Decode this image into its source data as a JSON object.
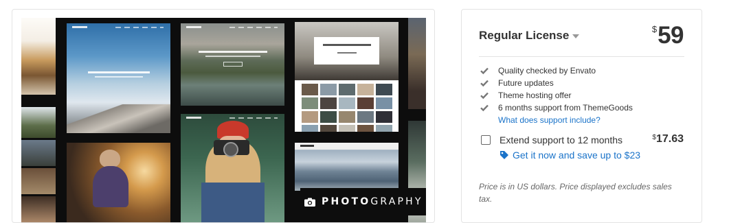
{
  "preview": {
    "logo_text_bold": "PHOTO",
    "logo_text_thin": "GRAPHY"
  },
  "purchase": {
    "license_title": "Regular License",
    "currency_symbol": "$",
    "price": "59",
    "features": [
      "Quality checked by Envato",
      "Future updates",
      "Theme hosting offer",
      "6 months support from ThemeGoods"
    ],
    "support_link": "What does support include?",
    "extend_label": "Extend support to 12 months",
    "extend_currency": "$",
    "extend_price": "17.63",
    "promo_text": "Get it now and save up to $23",
    "note": "Price is in US dollars. Price displayed excludes sales tax."
  },
  "colors": {
    "link": "#1a73c9",
    "border": "#e3e3e3",
    "text": "#333333"
  }
}
